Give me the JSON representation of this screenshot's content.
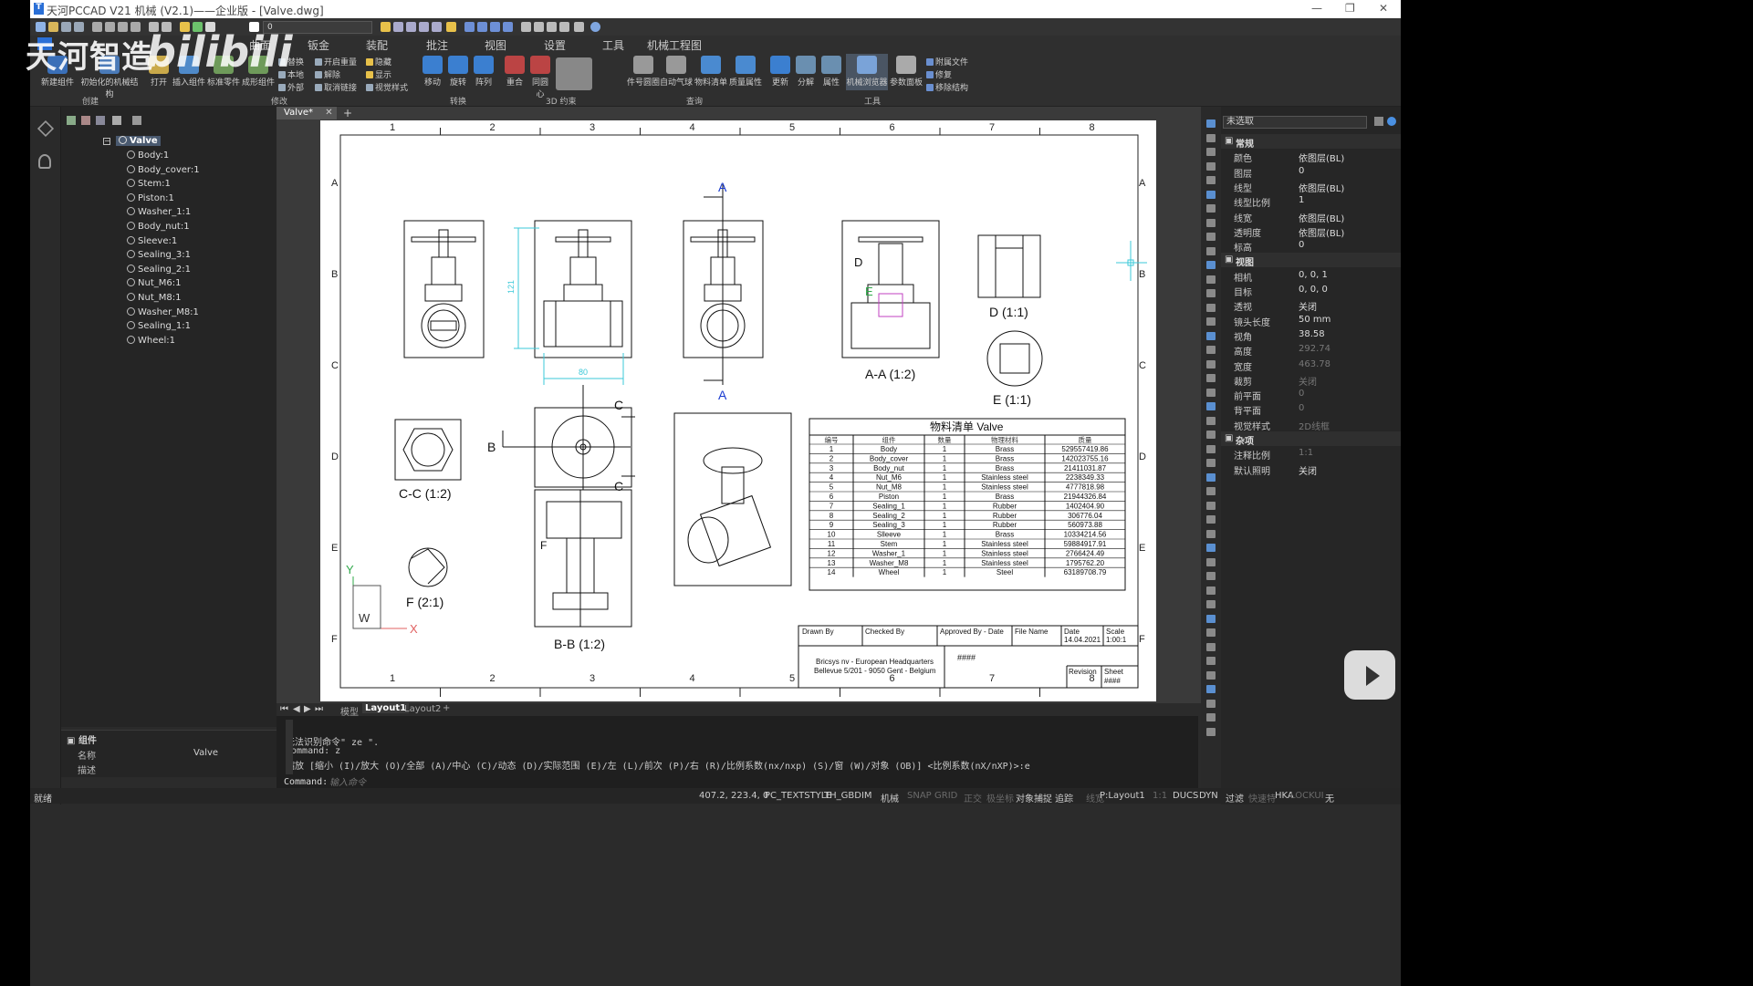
{
  "window": {
    "title": "天河PCCAD V21 机械 (V2.1)——企业版 - [Valve.dwg]"
  },
  "qat": {
    "layer_value": "0"
  },
  "tabs": [
    "曲面",
    "钣金",
    "装配",
    "批注",
    "视图",
    "设置",
    "工具",
    "机械工程图"
  ],
  "ribbon": {
    "buttons": [
      "新建组件",
      "初始化的机械结构",
      "打开",
      "插入组件",
      "标准零件",
      "成形组件",
      "移动",
      "旋转",
      "阵列",
      "重合",
      "同圆心",
      "件号圆圈",
      "自动气球",
      "物料清单",
      "质量属性",
      "更新",
      "分解",
      "属性",
      "机械浏览器",
      "参数面板"
    ],
    "small": [
      "替换",
      "开启重量",
      "隐藏",
      "本地",
      "解除",
      "显示",
      "外部",
      "取消链接",
      "视觉样式",
      "附属文件",
      "修复",
      "移除结构"
    ],
    "groups": [
      "创建",
      "修改",
      "转换",
      "3D 约束",
      "查询",
      "工具"
    ]
  },
  "doc": {
    "tab": "Valve*"
  },
  "tree": {
    "root": "Valve",
    "items": [
      "Body:1",
      "Body_cover:1",
      "Stem:1",
      "Piston:1",
      "Washer_1:1",
      "Body_nut:1",
      "Sleeve:1",
      "Sealing_3:1",
      "Sealing_2:1",
      "Nut_M6:1",
      "Nut_M8:1",
      "Washer_M8:1",
      "Sealing_1:1",
      "Wheel:1"
    ]
  },
  "component_panel": {
    "header": "组件",
    "rows": [
      {
        "k": "名称",
        "v": "Valve"
      },
      {
        "k": "描述",
        "v": ""
      }
    ]
  },
  "drawing": {
    "col_labels": [
      "1",
      "2",
      "3",
      "4",
      "5",
      "6",
      "7",
      "8"
    ],
    "row_labels": [
      "A",
      "B",
      "C",
      "D",
      "E",
      "F"
    ],
    "section_A": "A",
    "section_B": "B",
    "section_C": "C",
    "label_D": "D",
    "label_E": "E",
    "label_F": "F",
    "dim_121": "121",
    "dim_80": "80",
    "view_AA": "A-A (1:2)",
    "view_D": "D (1:1)",
    "view_E": "E (1:1)",
    "view_CC": "C-C (1:2)",
    "view_F": "F (2:1)",
    "view_BB": "B-B (1:2)",
    "ucs_y": "Y",
    "ucs_x": "X",
    "ucs_w": "W",
    "bom": {
      "title": "物料清单 Valve",
      "headers": [
        "编号",
        "组件",
        "数量",
        "物理材料",
        "质量"
      ],
      "rows": [
        [
          "1",
          "Body",
          "1",
          "Brass",
          "529557419.86"
        ],
        [
          "2",
          "Body_cover",
          "1",
          "Brass",
          "142023755.16"
        ],
        [
          "3",
          "Body_nut",
          "1",
          "Brass",
          "21411031.87"
        ],
        [
          "4",
          "Nut_M6",
          "1",
          "Stainless steel",
          "2238349.33"
        ],
        [
          "5",
          "Nut_M8",
          "1",
          "Stainless steel",
          "4777818.98"
        ],
        [
          "6",
          "Piston",
          "1",
          "Brass",
          "21944326.84"
        ],
        [
          "7",
          "Sealing_1",
          "1",
          "Rubber",
          "1402404.90"
        ],
        [
          "8",
          "Sealing_2",
          "1",
          "Rubber",
          "306776.04"
        ],
        [
          "9",
          "Sealing_3",
          "1",
          "Rubber",
          "560973.88"
        ],
        [
          "10",
          "Slleeve",
          "1",
          "Brass",
          "10334214.56"
        ],
        [
          "11",
          "Stem",
          "1",
          "Stainless steel",
          "59884917.91"
        ],
        [
          "12",
          "Washer_1",
          "1",
          "Stainless steel",
          "2766424.49"
        ],
        [
          "13",
          "Washer_M8",
          "1",
          "Stainless steel",
          "1795762.20"
        ],
        [
          "14",
          "Wheel",
          "1",
          "Steel",
          "63189708.79"
        ]
      ]
    },
    "titleblock": {
      "drawn_by": "Drawn By",
      "checked_by": "Checked By",
      "approved": "Approved By - Date",
      "file_name": "File Name",
      "date_label": "Date",
      "date": "14.04.2021",
      "scale_label": "Scale",
      "scale": "1:00:1",
      "company1": "Bricsys nv - European Headquarters",
      "company2": "Bellevue 5/201 - 9050 Gent - Belgium",
      "hash": "####",
      "revision": "Revision",
      "sheet": "Sheet",
      "sheet_val": "####"
    }
  },
  "layout_tabs": [
    "模型",
    "Layout1",
    "Layout2"
  ],
  "command": {
    "line1": "无法识别命令\" ze \".",
    "line2": "Command: z",
    "line3": "缩放 [缩小 (I)/放大 (O)/全部 (A)/中心 (C)/动态 (D)/实际范围 (E)/左 (L)/前次 (P)/右 (R)/比例系数(nx/nxp) (S)/窗 (W)/对象 (OB)] <比例系数(nX/nXP)>:e",
    "prompt": "Command:",
    "placeholder": "输入命令"
  },
  "properties": {
    "selector": "未选取",
    "general_header": "常规",
    "general": [
      {
        "k": "颜色",
        "v": "依图层(BL)"
      },
      {
        "k": "图层",
        "v": "0"
      },
      {
        "k": "线型",
        "v": "依图层(BL)"
      },
      {
        "k": "线型比例",
        "v": "1"
      },
      {
        "k": "线宽",
        "v": "依图层(BL)"
      },
      {
        "k": "透明度",
        "v": "依图层(BL)"
      },
      {
        "k": "标高",
        "v": "0"
      }
    ],
    "view_header": "视图",
    "view": [
      {
        "k": "相机",
        "v": "0, 0, 1"
      },
      {
        "k": "目标",
        "v": "0, 0, 0"
      },
      {
        "k": "透视",
        "v": "关闭"
      },
      {
        "k": "镜头长度",
        "v": "50 mm"
      },
      {
        "k": "视角",
        "v": "38.58"
      },
      {
        "k": "高度",
        "v": "292.74"
      },
      {
        "k": "宽度",
        "v": "463.78"
      },
      {
        "k": "裁剪",
        "v": "关闭"
      },
      {
        "k": "前平面",
        "v": "0"
      },
      {
        "k": "背平面",
        "v": "0"
      },
      {
        "k": "视觉样式",
        "v": "2D线框"
      }
    ],
    "misc_header": "杂项",
    "misc": [
      {
        "k": "注释比例",
        "v": "1:1"
      },
      {
        "k": "默认照明",
        "v": "关闭"
      }
    ]
  },
  "status": {
    "left": "就绪",
    "coords": "407.2, 223.4, 0",
    "items": [
      "PC_TEXTSTYLE",
      "TH_GBDIM",
      "机械",
      "SNAP",
      "GRID",
      "正交",
      "极坐标",
      "对象捕捉",
      "追踪",
      "线宽",
      "P:Layout1",
      "1:1",
      "DUCS",
      "DYN",
      "过滤",
      "快速特",
      "HKA",
      "LOCKUI",
      "无"
    ]
  },
  "watermark": {
    "text": "天河智造",
    "brand": "bilibili"
  }
}
